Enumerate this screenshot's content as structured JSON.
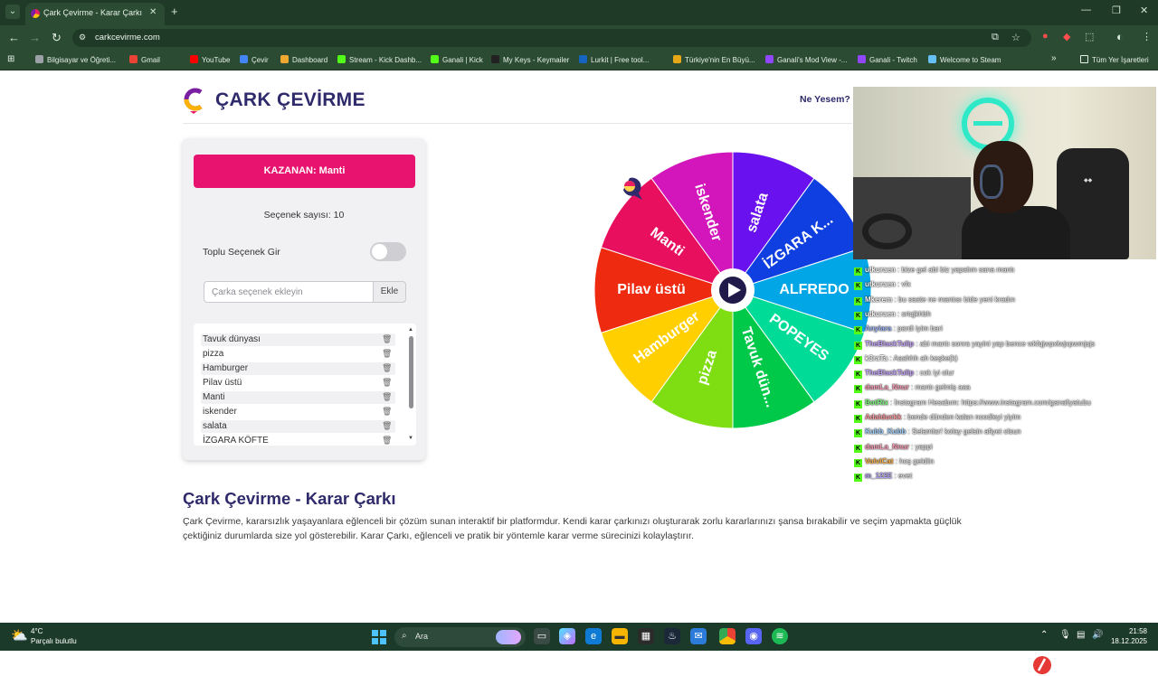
{
  "browser": {
    "tab_title": "Çark Çevirme - Karar Çarkı",
    "url": "carkcevirme.com",
    "bookmarks": [
      {
        "label": "Bilgisayar ve Öğreti...",
        "color": "#9aa0a6"
      },
      {
        "label": "Gmail",
        "color": "#ea4335"
      },
      {
        "label": "YouTube",
        "color": "#ff0000"
      },
      {
        "label": "Çevir",
        "color": "#4285f4"
      },
      {
        "label": "Dashboard",
        "color": "#f0a830"
      },
      {
        "label": "Stream - Kick Dashb...",
        "color": "#53fc18"
      },
      {
        "label": "Ganali | Kick",
        "color": "#53fc18"
      },
      {
        "label": "My Keys - Keymailer",
        "color": "#222222"
      },
      {
        "label": "Lurkit | Free tool...",
        "color": "#1565c0"
      },
      {
        "label": "Türkiye'nin En Büyü...",
        "color": "#e6a817"
      },
      {
        "label": "Ganali's Mod View -...",
        "color": "#9146ff"
      },
      {
        "label": "Ganali - Twitch",
        "color": "#9146ff"
      },
      {
        "label": "Welcome to Steam",
        "color": "#66c0f4"
      }
    ],
    "all_bookmarks": "Tüm Yer İşaretleri"
  },
  "site": {
    "logo": "ÇARK ÇEVİRME",
    "nav_link": "Ne Yesem?"
  },
  "panel": {
    "winner": "KAZANAN: Manti",
    "option_count": "Seçenek sayısı: 10",
    "bulk_label": "Toplu Seçenek Gir",
    "bulk_enabled": false,
    "input_placeholder": "Çarka seçenek ekleyin",
    "add_button": "Ekle",
    "options": [
      "Tavuk dünyası",
      "pizza",
      "Hamburger",
      "Pilav üstü",
      "Manti",
      "iskender",
      "salata",
      "İZGARA KÖFTE"
    ]
  },
  "wheel": {
    "segments": [
      {
        "label": "salata",
        "color": "#6a11f0"
      },
      {
        "label": "İZGARA K...",
        "color": "#0f3fe0"
      },
      {
        "label": "ALFREDO",
        "color": "#00a6e6"
      },
      {
        "label": "POPEYES",
        "color": "#00dc97"
      },
      {
        "label": "Tavuk dün...",
        "color": "#00c94a"
      },
      {
        "label": "pizza",
        "color": "#7fde12"
      },
      {
        "label": "Hamburger",
        "color": "#ffcf00"
      },
      {
        "label": "Pilav üstü",
        "color": "#ee2a10"
      },
      {
        "label": "Manti",
        "color": "#e8105e"
      },
      {
        "label": "iskender",
        "color": "#d316bb"
      }
    ],
    "play_label": "play-icon"
  },
  "content": {
    "heading": "Çark Çevirme - Karar Çarkı",
    "paragraph": "Çark Çevirme, kararsızlık yaşayanlara eğlenceli bir çözüm sunan interaktif bir platformdur. Kendi karar çarkınızı oluşturarak zorlu kararlarınızı şansa bırakabilir ve seçim yapmakta güçlük çektiğiniz durumlarda size yol gösterebilir. Karar Çarkı, eğlenceli ve pratik bir yöntemle karar verme sürecinizi kolaylaştırır."
  },
  "chat": [
    {
      "user": "utkuraen",
      "color": "#ffffff",
      "msg": "bize gel abi biz yapalım sana mantı"
    },
    {
      "user": "utkuraen",
      "color": "#ffffff",
      "msg": "vfx"
    },
    {
      "user": "Mkerem",
      "color": "#ffffff",
      "msg": "bu saate ne mantısı bide yeni kradın"
    },
    {
      "user": "utkuraen",
      "color": "#ffffff",
      "msg": "srtqjkhbh"
    },
    {
      "user": "Anyiara",
      "color": "#9fb7ff",
      "msg": "pardi iyim bari"
    },
    {
      "user": "TheBlackTulip",
      "color": "#c9a6ff",
      "msg": "abi mantı sonra yayini yap bence wkfqjwpxlwjxpwmjsjs"
    },
    {
      "user": "k3raTa",
      "color": "#ffffff",
      "msg": "Aaahhh ah keşke(k)"
    },
    {
      "user": "TheBlackTulip",
      "color": "#c9a6ff",
      "msg": "cok iyi olur"
    },
    {
      "user": "damLa_Nnur",
      "color": "#ff9fb8",
      "msg": "mantı gelmiş aaa"
    },
    {
      "user": "BotRix",
      "color": "#7fff7f",
      "msg": "İnstagram Hesabım: https://www.instagram.com/ganaliyatubu"
    },
    {
      "user": "Adalduckk",
      "color": "#ff9aa2",
      "msg": "bende dünden kalan noodleyi yiyim"
    },
    {
      "user": "Kubb_Kubb",
      "color": "#9fd0ff",
      "msg": "Selamlar! kolay gelsin afiyet olsun"
    },
    {
      "user": "damLa_Nnur",
      "color": "#ff9fb8",
      "msg": "yappi"
    },
    {
      "user": "VolviCat",
      "color": "#ffb347",
      "msg": "hoş geldiin"
    },
    {
      "user": "m_122E",
      "color": "#b9a7ff",
      "msg": "evet"
    }
  ],
  "taskbar": {
    "temp": "4°C",
    "weather": "Parçalı bulutlu",
    "search": "Ara",
    "time": "21:58",
    "date": "18.12.2025"
  }
}
